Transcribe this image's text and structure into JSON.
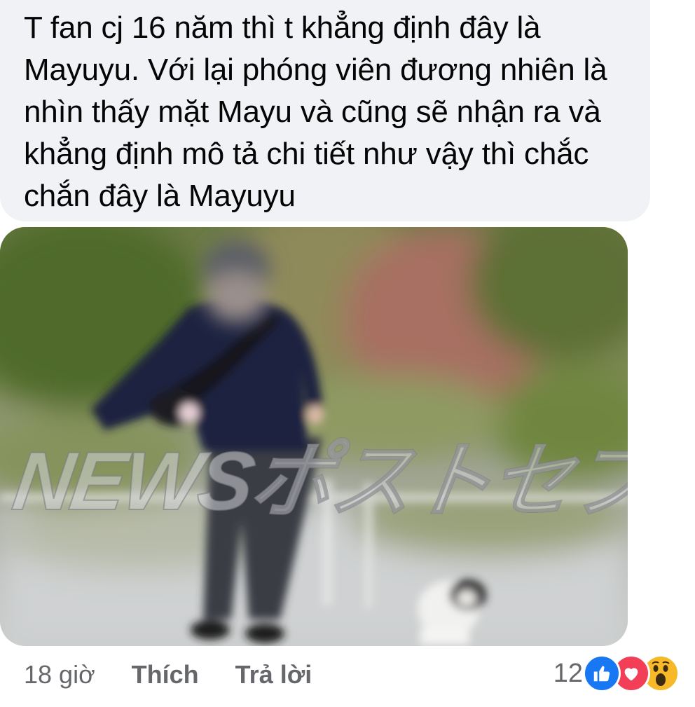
{
  "comment": {
    "text": "T fan cj 16 năm thì t khẳng định đây là\nMayuyu. Với lại phóng viên đương nhiên là\nnhìn thấy mặt Mayu và cũng sẽ nhận ra và\nkhẳng định mô tả chi tiết như vậy thì chắc\nchắn đây là Mayuyu"
  },
  "attachment": {
    "watermark": "NEWSポストセブン"
  },
  "actions": {
    "timestamp": "18 giờ",
    "like_label": "Thích",
    "reply_label": "Trả lời"
  },
  "reactions": {
    "count": "12",
    "types": [
      "like-icon",
      "love-icon",
      "wow-icon"
    ]
  },
  "colors": {
    "bubble": "#f0f2f5",
    "text": "#050505",
    "meta": "#65676b",
    "like": "#1877f2",
    "love": "#f33e58",
    "wow": "#f7b928"
  }
}
